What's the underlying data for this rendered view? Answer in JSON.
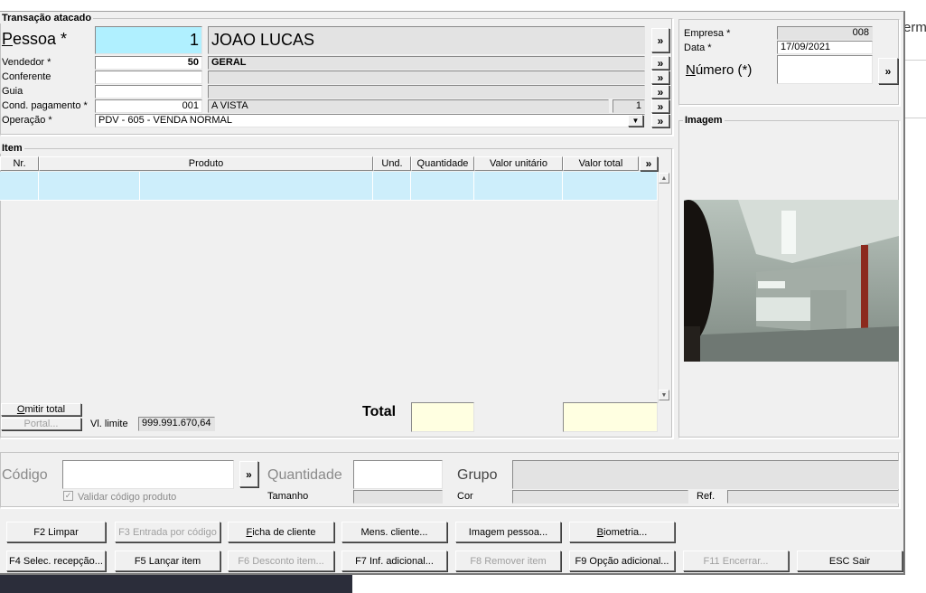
{
  "background": {
    "text": "erm"
  },
  "transacao": {
    "title": "Transação atacado",
    "pessoa": {
      "label": "Pessoa *",
      "code": "1",
      "name": "JOAO LUCAS"
    },
    "vendedor": {
      "label": "Vendedor *",
      "code": "50",
      "name": "GERAL"
    },
    "conferente": {
      "label": "Conferente",
      "code": "",
      "name": ""
    },
    "guia": {
      "label": "Guia",
      "code": "",
      "name": ""
    },
    "cond_pagamento": {
      "label": "Cond. pagamento *",
      "code": "001",
      "name": "A VISTA",
      "parcelas": "1"
    },
    "operacao": {
      "label": "Operação *",
      "value": "PDV - 605 - VENDA NORMAL"
    },
    "more": "»"
  },
  "empresa": {
    "empresa_label": "Empresa *",
    "empresa_value": "008",
    "data_label": "Data *",
    "data_value": "17/09/2021",
    "numero_label": "Número (*)",
    "numero_value": ""
  },
  "imagem": {
    "title": "Imagem"
  },
  "item": {
    "title": "Item",
    "columns": [
      "Nr.",
      "Produto",
      "Und.",
      "Quantidade",
      "Valor unitário",
      "Valor total",
      "»"
    ],
    "omitir_total": "Omitir total",
    "portal": "Portal...",
    "vl_limite_label": "Vl. limite",
    "vl_limite_value": "999.991.670,64",
    "total_label": "Total",
    "total_qtd": "",
    "total_valor": ""
  },
  "entry": {
    "codigo_label": "Código",
    "codigo_value": "",
    "quantidade_label": "Quantidade",
    "quantidade_value": "",
    "grupo_label": "Grupo",
    "grupo_value": "",
    "validar_label": "Validar código produto",
    "validar_checked": true,
    "tamanho_label": "Tamanho",
    "cor_label": "Cor",
    "ref_label": "Ref."
  },
  "buttons": {
    "row1": [
      "F2 Limpar",
      "F3 Entrada por código",
      "Ficha de cliente",
      "Mens. cliente...",
      "Imagem pessoa...",
      "Biometria..."
    ],
    "row2": [
      "F4 Selec. recepção...",
      "F5 Lançar item",
      "F6 Desconto item...",
      "F7 Inf. adicional...",
      "F8 Remover item",
      "F9 Opção adicional...",
      "F11 Encerrar...",
      "ESC Sair"
    ]
  },
  "colors": {
    "highlight": "#cdeefb",
    "total_bg": "#ffffe1",
    "pessoa_bg": "#b0f0ff"
  }
}
